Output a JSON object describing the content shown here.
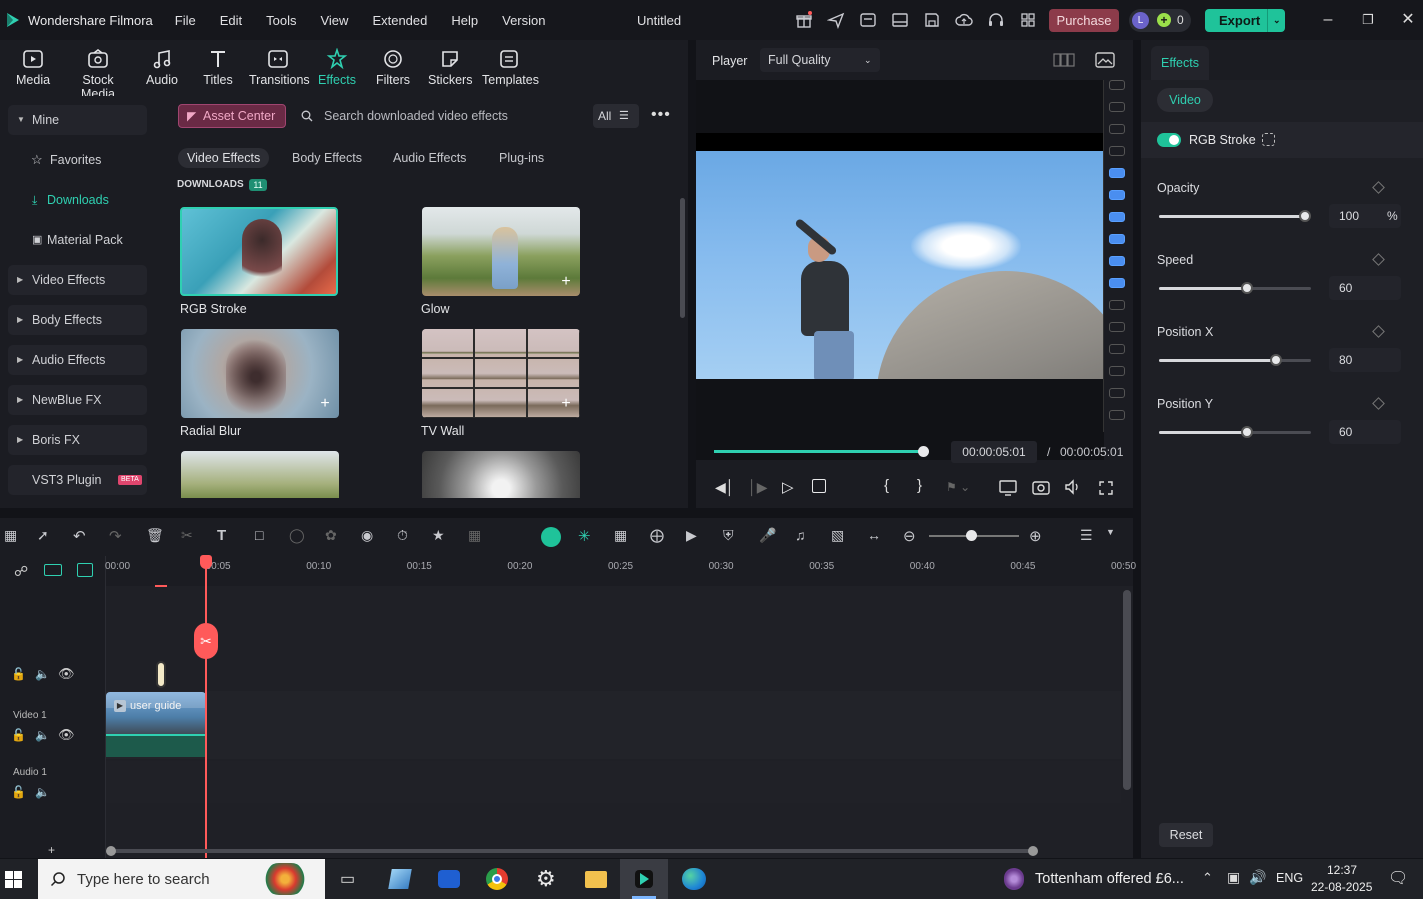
{
  "app": {
    "name": "Wondershare Filmora",
    "doc_title": "Untitled"
  },
  "menu": [
    "File",
    "Edit",
    "Tools",
    "View",
    "Extended",
    "Help",
    "Version"
  ],
  "header": {
    "purchase": "Purchase",
    "credits": "0",
    "avatar_letter": "L",
    "export": "Export"
  },
  "toolbar": [
    {
      "label": "Media",
      "icon": "media-icon"
    },
    {
      "label": "Stock Media",
      "icon": "stock-media-icon"
    },
    {
      "label": "Audio",
      "icon": "audio-icon"
    },
    {
      "label": "Titles",
      "icon": "titles-icon"
    },
    {
      "label": "Transitions",
      "icon": "transitions-icon"
    },
    {
      "label": "Effects",
      "icon": "effects-icon",
      "active": true
    },
    {
      "label": "Filters",
      "icon": "filters-icon"
    },
    {
      "label": "Stickers",
      "icon": "stickers-icon"
    },
    {
      "label": "Templates",
      "icon": "templates-icon"
    }
  ],
  "sidebar": {
    "mine": "Mine",
    "sub": [
      "Favorites",
      "Downloads",
      "Material Pack"
    ],
    "groups": [
      "Video Effects",
      "Body Effects",
      "Audio Effects",
      "NewBlue FX",
      "Boris FX",
      "VST3 Plugin"
    ],
    "beta": "BETA"
  },
  "browser": {
    "asset_center": "Asset Center",
    "search_placeholder": "Search downloaded video effects",
    "filter": "All",
    "tabs": [
      "Video Effects",
      "Body Effects",
      "Audio Effects",
      "Plug-ins"
    ],
    "section": "DOWNLOADS",
    "count": "11",
    "items": [
      "RGB Stroke",
      "Glow",
      "Radial Blur",
      "TV Wall"
    ]
  },
  "player": {
    "label": "Player",
    "quality": "Full Quality",
    "current": "00:00:05:01",
    "separator": "/",
    "total": "00:00:05:01",
    "progress": 1.0
  },
  "effects_panel": {
    "tab": "Effects",
    "subtab": "Video",
    "effect_name": "RGB Stroke",
    "enabled": true,
    "props": [
      {
        "label": "Opacity",
        "value": "100",
        "unit": "%",
        "level": 1.0
      },
      {
        "label": "Speed",
        "value": "60",
        "unit": "",
        "level": 0.6
      },
      {
        "label": "Position X",
        "value": "80",
        "unit": "",
        "level": 0.8
      },
      {
        "label": "Position Y",
        "value": "60",
        "unit": "",
        "level": 0.6
      }
    ],
    "reset": "Reset"
  },
  "timeline": {
    "ruler": [
      "00:00",
      "00:05",
      "00:10",
      "00:15",
      "00:20",
      "00:25",
      "00:30",
      "00:35",
      "00:40",
      "00:45",
      "00:50"
    ],
    "tracks": [
      "Video 1",
      "Audio 1"
    ],
    "clip_label": "user guide"
  },
  "taskbar": {
    "search": "Type here to search",
    "news": "Tottenham offered £6...",
    "lang": "ENG",
    "time": "12:37",
    "date": "22-08-2025"
  },
  "colors": {
    "accent": "#2fd0b1",
    "export": "#1fc39a",
    "purchase": "#8c3b4a",
    "playhead": "#ff5a5a"
  }
}
